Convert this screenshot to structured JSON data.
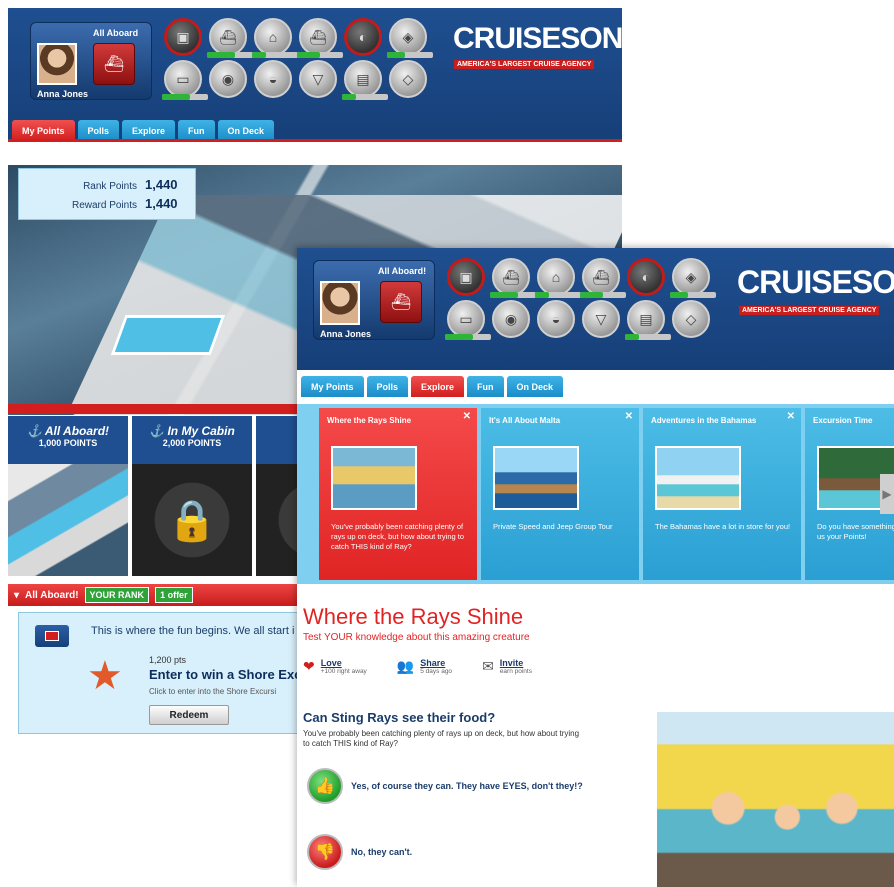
{
  "brand": {
    "logo_text": "CRUISESONLY",
    "logo_mark": "®",
    "tagline": "AMERICA'S LARGEST CRUISE AGENCY"
  },
  "profile": {
    "label": "All Aboard",
    "name": "Anna Jones"
  },
  "badges": [
    {
      "icon": "suitcase-icon",
      "ring": true,
      "progress": null
    },
    {
      "icon": "ship-icon",
      "ring": false,
      "progress": 0.6
    },
    {
      "icon": "arch-icon",
      "ring": false,
      "progress": 0.3
    },
    {
      "icon": "ship-icon",
      "ring": false,
      "progress": 0.5
    },
    {
      "icon": "snorkel-icon",
      "ring": true,
      "progress": null
    },
    {
      "icon": "theater-icon",
      "ring": false,
      "progress": 0.4
    },
    {
      "icon": "bed-icon",
      "ring": false,
      "progress": 0.6
    },
    {
      "icon": "mask-icon",
      "ring": false,
      "progress": null
    },
    {
      "icon": "dish-icon",
      "ring": false,
      "progress": null
    },
    {
      "icon": "cocktail-icon",
      "ring": false,
      "progress": null
    },
    {
      "icon": "cabin-icon",
      "ring": false,
      "progress": 0.3
    },
    {
      "icon": "spa-icon",
      "ring": false,
      "progress": null
    }
  ],
  "tabs": [
    "My Points",
    "Polls",
    "Explore",
    "Fun",
    "On Deck"
  ],
  "window1": {
    "active_tab": 0,
    "points": [
      {
        "label": "Rank Points",
        "value": "1,440"
      },
      {
        "label": "Reward Points",
        "value": "1,440"
      }
    ],
    "cards": [
      {
        "title": "All Aboard!",
        "points": "1,000 POINTS",
        "image": "ship"
      },
      {
        "title": "In My Cabin",
        "points": "2,000 POINTS",
        "image": "locked"
      }
    ],
    "rank_bar": {
      "label": "All Aboard!",
      "rank": "YOUR RANK",
      "offers": "1 offer"
    },
    "offer": {
      "intro": "This is where the fun begins. We all start i",
      "pts": "1,200 pts",
      "title": "Enter to win a Shore Excu",
      "desc": "Click to enter into the Shore Excursi",
      "button": "Redeem"
    }
  },
  "window2": {
    "profile_label": "All Aboard!",
    "active_tab": 2,
    "explore_cards": [
      {
        "title": "Where the Rays Shine",
        "desc": "You've probably been catching plenty of rays up on deck, but how about trying to catch THIS kind of Ray?",
        "active": true,
        "image": "people"
      },
      {
        "title": "It's All About Malta",
        "desc": "Private Speed and Jeep Group Tour",
        "active": false,
        "image": "arch"
      },
      {
        "title": "Adventures in the Bahamas",
        "desc": "The Bahamas have a lot in store for you!",
        "active": false,
        "image": "bahamas"
      },
      {
        "title": "Excursion Time",
        "desc": "Do you have something to share? Send us your Points!",
        "active": false,
        "image": "island"
      }
    ],
    "article": {
      "title": "Where the Rays Shine",
      "subtitle": "Test YOUR knowledge about this amazing creature",
      "actions": [
        {
          "label": "Love",
          "meta": "+100 right away",
          "icon": "heart-icon"
        },
        {
          "label": "Share",
          "meta": "5 days ago",
          "icon": "people-icon"
        },
        {
          "label": "Invite",
          "meta": "earn points",
          "icon": "mail-icon"
        }
      ],
      "question": "Can Sting Rays see their food?",
      "question_desc": "You've probably been catching plenty of rays up on deck, but how about trying to catch THIS kind of Ray?",
      "answers": [
        {
          "text": "Yes, of course they can. They have EYES, don't they!?",
          "kind": "yes"
        },
        {
          "text": "No, they can't.",
          "kind": "no"
        }
      ]
    }
  },
  "colors": {
    "header_blue": "#1f4f90",
    "accent_red": "#d21e1e",
    "tab_blue": "#1a8cc8",
    "panel_light": "#d8f0fb"
  }
}
